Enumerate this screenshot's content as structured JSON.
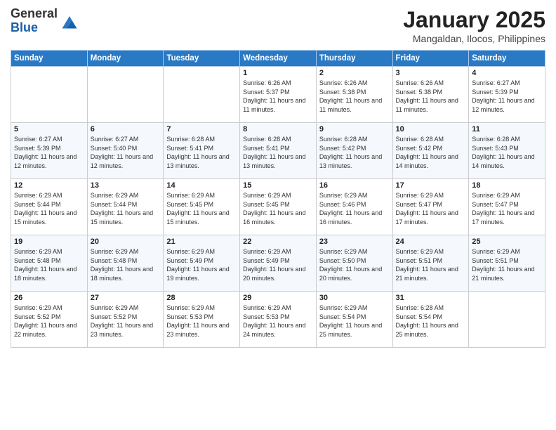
{
  "logo": {
    "general": "General",
    "blue": "Blue"
  },
  "header": {
    "month": "January 2025",
    "location": "Mangaldan, Ilocos, Philippines"
  },
  "days_of_week": [
    "Sunday",
    "Monday",
    "Tuesday",
    "Wednesday",
    "Thursday",
    "Friday",
    "Saturday"
  ],
  "weeks": [
    [
      {
        "day": "",
        "info": ""
      },
      {
        "day": "",
        "info": ""
      },
      {
        "day": "",
        "info": ""
      },
      {
        "day": "1",
        "info": "Sunrise: 6:26 AM\nSunset: 5:37 PM\nDaylight: 11 hours and 11 minutes."
      },
      {
        "day": "2",
        "info": "Sunrise: 6:26 AM\nSunset: 5:38 PM\nDaylight: 11 hours and 11 minutes."
      },
      {
        "day": "3",
        "info": "Sunrise: 6:26 AM\nSunset: 5:38 PM\nDaylight: 11 hours and 11 minutes."
      },
      {
        "day": "4",
        "info": "Sunrise: 6:27 AM\nSunset: 5:39 PM\nDaylight: 11 hours and 12 minutes."
      }
    ],
    [
      {
        "day": "5",
        "info": "Sunrise: 6:27 AM\nSunset: 5:39 PM\nDaylight: 11 hours and 12 minutes."
      },
      {
        "day": "6",
        "info": "Sunrise: 6:27 AM\nSunset: 5:40 PM\nDaylight: 11 hours and 12 minutes."
      },
      {
        "day": "7",
        "info": "Sunrise: 6:28 AM\nSunset: 5:41 PM\nDaylight: 11 hours and 13 minutes."
      },
      {
        "day": "8",
        "info": "Sunrise: 6:28 AM\nSunset: 5:41 PM\nDaylight: 11 hours and 13 minutes."
      },
      {
        "day": "9",
        "info": "Sunrise: 6:28 AM\nSunset: 5:42 PM\nDaylight: 11 hours and 13 minutes."
      },
      {
        "day": "10",
        "info": "Sunrise: 6:28 AM\nSunset: 5:42 PM\nDaylight: 11 hours and 14 minutes."
      },
      {
        "day": "11",
        "info": "Sunrise: 6:28 AM\nSunset: 5:43 PM\nDaylight: 11 hours and 14 minutes."
      }
    ],
    [
      {
        "day": "12",
        "info": "Sunrise: 6:29 AM\nSunset: 5:44 PM\nDaylight: 11 hours and 15 minutes."
      },
      {
        "day": "13",
        "info": "Sunrise: 6:29 AM\nSunset: 5:44 PM\nDaylight: 11 hours and 15 minutes."
      },
      {
        "day": "14",
        "info": "Sunrise: 6:29 AM\nSunset: 5:45 PM\nDaylight: 11 hours and 15 minutes."
      },
      {
        "day": "15",
        "info": "Sunrise: 6:29 AM\nSunset: 5:45 PM\nDaylight: 11 hours and 16 minutes."
      },
      {
        "day": "16",
        "info": "Sunrise: 6:29 AM\nSunset: 5:46 PM\nDaylight: 11 hours and 16 minutes."
      },
      {
        "day": "17",
        "info": "Sunrise: 6:29 AM\nSunset: 5:47 PM\nDaylight: 11 hours and 17 minutes."
      },
      {
        "day": "18",
        "info": "Sunrise: 6:29 AM\nSunset: 5:47 PM\nDaylight: 11 hours and 17 minutes."
      }
    ],
    [
      {
        "day": "19",
        "info": "Sunrise: 6:29 AM\nSunset: 5:48 PM\nDaylight: 11 hours and 18 minutes."
      },
      {
        "day": "20",
        "info": "Sunrise: 6:29 AM\nSunset: 5:48 PM\nDaylight: 11 hours and 18 minutes."
      },
      {
        "day": "21",
        "info": "Sunrise: 6:29 AM\nSunset: 5:49 PM\nDaylight: 11 hours and 19 minutes."
      },
      {
        "day": "22",
        "info": "Sunrise: 6:29 AM\nSunset: 5:49 PM\nDaylight: 11 hours and 20 minutes."
      },
      {
        "day": "23",
        "info": "Sunrise: 6:29 AM\nSunset: 5:50 PM\nDaylight: 11 hours and 20 minutes."
      },
      {
        "day": "24",
        "info": "Sunrise: 6:29 AM\nSunset: 5:51 PM\nDaylight: 11 hours and 21 minutes."
      },
      {
        "day": "25",
        "info": "Sunrise: 6:29 AM\nSunset: 5:51 PM\nDaylight: 11 hours and 21 minutes."
      }
    ],
    [
      {
        "day": "26",
        "info": "Sunrise: 6:29 AM\nSunset: 5:52 PM\nDaylight: 11 hours and 22 minutes."
      },
      {
        "day": "27",
        "info": "Sunrise: 6:29 AM\nSunset: 5:52 PM\nDaylight: 11 hours and 23 minutes."
      },
      {
        "day": "28",
        "info": "Sunrise: 6:29 AM\nSunset: 5:53 PM\nDaylight: 11 hours and 23 minutes."
      },
      {
        "day": "29",
        "info": "Sunrise: 6:29 AM\nSunset: 5:53 PM\nDaylight: 11 hours and 24 minutes."
      },
      {
        "day": "30",
        "info": "Sunrise: 6:29 AM\nSunset: 5:54 PM\nDaylight: 11 hours and 25 minutes."
      },
      {
        "day": "31",
        "info": "Sunrise: 6:28 AM\nSunset: 5:54 PM\nDaylight: 11 hours and 25 minutes."
      },
      {
        "day": "",
        "info": ""
      }
    ]
  ]
}
